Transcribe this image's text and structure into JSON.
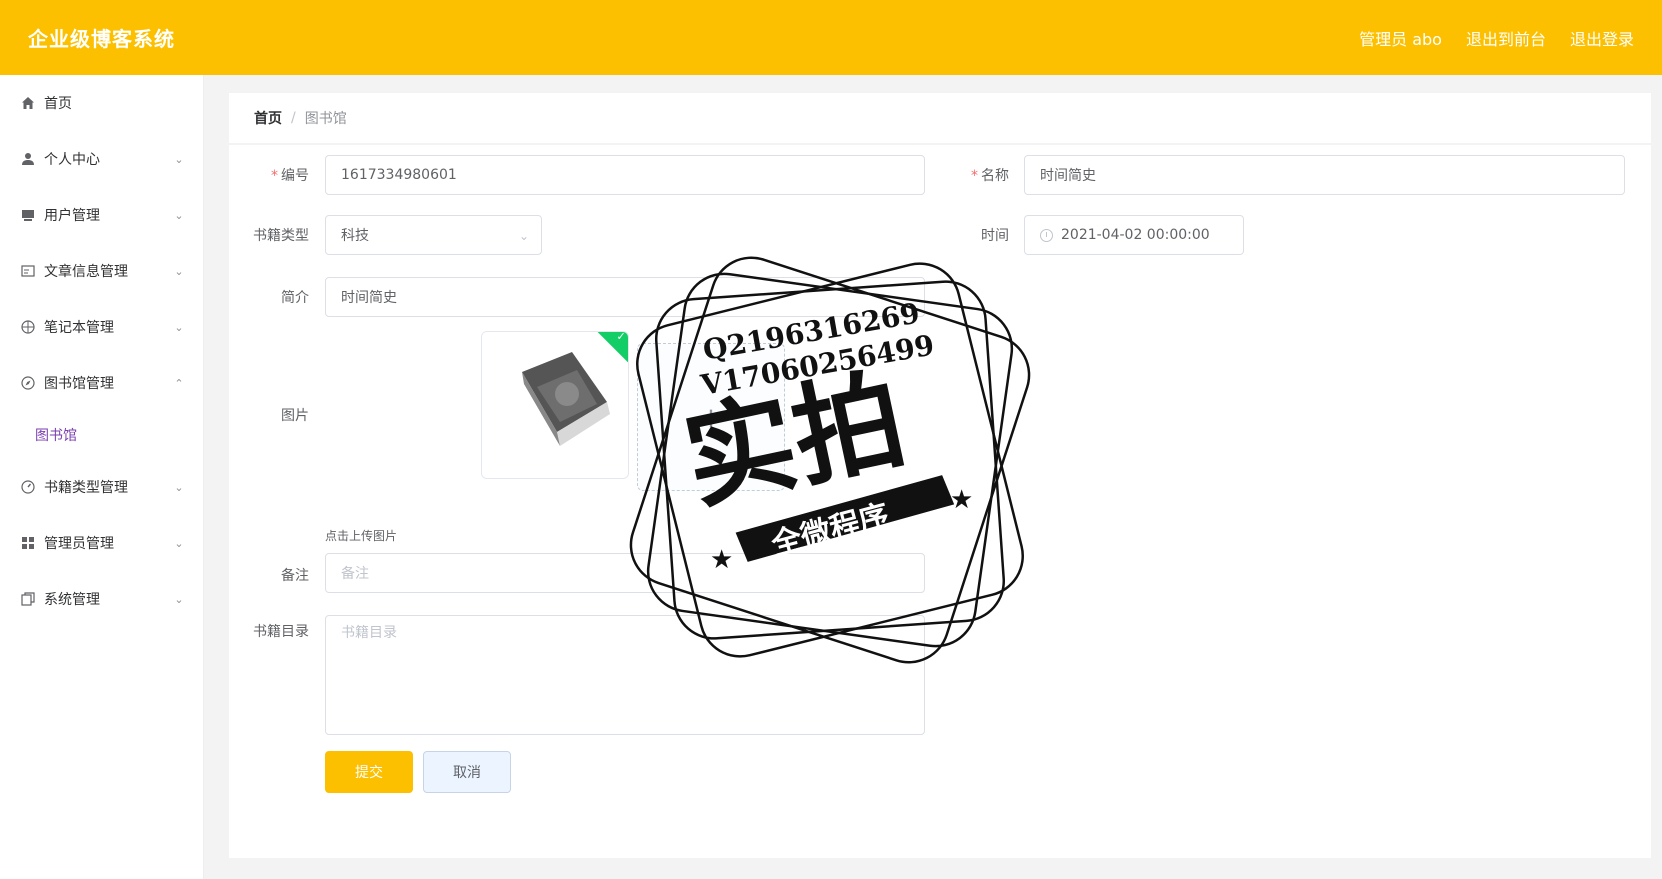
{
  "header": {
    "title": "企业级博客系统",
    "user_label": "管理员 abo",
    "front_link": "退出到前台",
    "logout_link": "退出登录"
  },
  "sidebar": {
    "items": [
      {
        "label": "首页",
        "icon": "home-icon"
      },
      {
        "label": "个人中心",
        "icon": "user-icon"
      },
      {
        "label": "用户管理",
        "icon": "computer-icon"
      },
      {
        "label": "文章信息管理",
        "icon": "document-icon"
      },
      {
        "label": "笔记本管理",
        "icon": "aperture-icon"
      },
      {
        "label": "图书馆管理",
        "icon": "compass-icon"
      },
      {
        "label": "书籍类型管理",
        "icon": "gauge-icon"
      },
      {
        "label": "管理员管理",
        "icon": "grid-icon"
      },
      {
        "label": "系统管理",
        "icon": "copy-icon"
      }
    ],
    "submenu_active": "图书馆"
  },
  "breadcrumb": {
    "home": "首页",
    "separator": "/",
    "current": "图书馆"
  },
  "form": {
    "id_label": "编号",
    "id_value": "1617334980601",
    "name_label": "名称",
    "name_value": "时间简史",
    "type_label": "书籍类型",
    "type_value": "科技",
    "time_label": "时间",
    "time_value": "2021-04-02 00:00:00",
    "intro_label": "简介",
    "intro_value": "时间简史",
    "image_label": "图片",
    "upload_plus": "+",
    "upload_check": "✓",
    "upload_tip": "点击上传图片",
    "remark_label": "备注",
    "remark_placeholder": "备注",
    "catalog_label": "书籍目录",
    "catalog_placeholder": "书籍目录",
    "required_mark": "*",
    "submit_label": "提交",
    "cancel_label": "取消"
  },
  "watermark": {
    "line1": "Q2196316269",
    "line2": "V17060256499",
    "main": "实拍",
    "banner": "全微程序"
  },
  "colors": {
    "header_bg": "#fcc000",
    "active_submenu": "#7b3fb0",
    "required": "#f56c6c",
    "success_badge": "#13ce66"
  }
}
